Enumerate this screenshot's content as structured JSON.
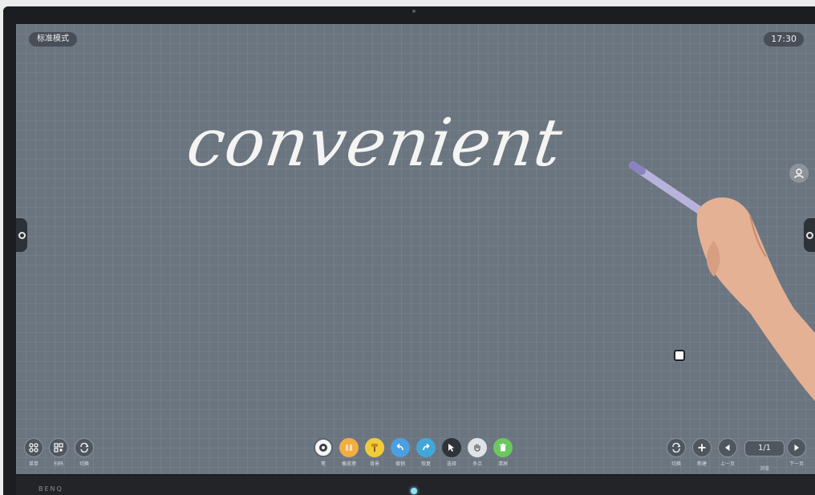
{
  "screen": {
    "mode_label": "标准模式",
    "clock": "17:30",
    "board_text": "convenient"
  },
  "left_tools": [
    {
      "name": "menu-button",
      "icon": "grid-icon",
      "label": "菜单"
    },
    {
      "name": "scan-button",
      "icon": "qr-icon",
      "label": "扫码"
    },
    {
      "name": "switch-left-button",
      "icon": "swap-icon",
      "label": "切换"
    }
  ],
  "center_tools": [
    {
      "name": "pen-tool",
      "icon": "pen-icon",
      "label": "笔",
      "style": "white"
    },
    {
      "name": "eraser-tool",
      "icon": "eraser-icon",
      "label": "橡皮擦",
      "style": "orange"
    },
    {
      "name": "highlighter-tool",
      "icon": "brush-icon",
      "label": "背景",
      "style": "yellow"
    },
    {
      "name": "undo-tool",
      "icon": "undo-icon",
      "label": "撤销",
      "style": "blue"
    },
    {
      "name": "redo-tool",
      "icon": "redo-icon",
      "label": "恢复",
      "style": "blue2"
    },
    {
      "name": "select-tool",
      "icon": "cursor-icon",
      "label": "选择",
      "style": "dark"
    },
    {
      "name": "multitouch-tool",
      "icon": "hand-icon",
      "label": "多点",
      "style": "lgray"
    },
    {
      "name": "clear-tool",
      "icon": "trash-icon",
      "label": "清屏",
      "style": "green"
    }
  ],
  "right_tools": [
    {
      "name": "switch-right-button",
      "icon": "swap-icon",
      "label": "切换"
    },
    {
      "name": "new-page-button",
      "icon": "plus-icon",
      "label": "新建"
    },
    {
      "name": "prev-page-button",
      "icon": "triangle-left-icon",
      "label": "上一页"
    }
  ],
  "pager": {
    "value": "1/1",
    "caption": "浏览",
    "next_label": "下一页"
  },
  "device": {
    "brand": "BENQ"
  },
  "colors": {
    "board": "#6b7580",
    "bezel": "#1c1d20",
    "ink": "#f4f4f2"
  }
}
